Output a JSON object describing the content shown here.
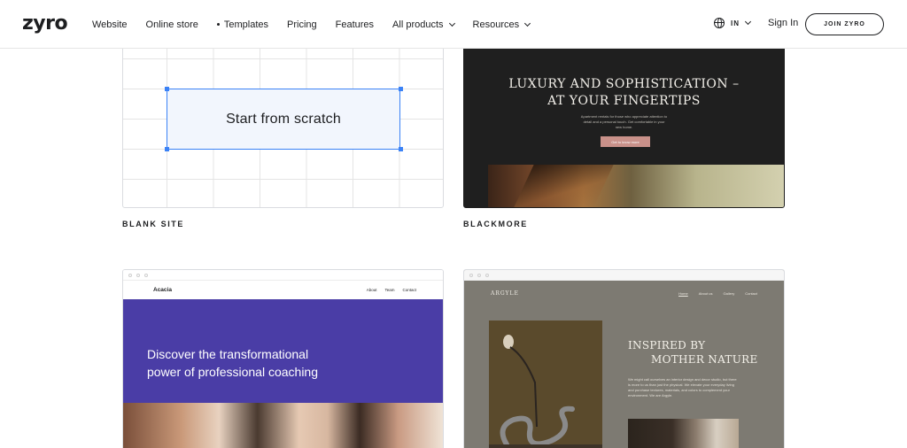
{
  "header": {
    "logo": "zyro",
    "nav": [
      {
        "label": "Website",
        "dot": false,
        "dropdown": false
      },
      {
        "label": "Online store",
        "dot": false,
        "dropdown": false
      },
      {
        "label": "Templates",
        "dot": true,
        "dropdown": false
      },
      {
        "label": "Pricing",
        "dot": false,
        "dropdown": false
      },
      {
        "label": "Features",
        "dot": false,
        "dropdown": false
      },
      {
        "label": "All products",
        "dot": false,
        "dropdown": true
      },
      {
        "label": "Resources",
        "dot": false,
        "dropdown": true
      }
    ],
    "language": "IN",
    "sign_in": "Sign In",
    "join": "JOIN ZYRO"
  },
  "templates": {
    "blank": {
      "name": "BLANK SITE",
      "preview_text": "Start from scratch"
    },
    "blackmore": {
      "name": "BLACKMORE",
      "headline_line1": "LUXURY AND SOPHISTICATION –",
      "headline_line2": "AT YOUR FINGERTIPS",
      "sub": "Apartment rentals for those who appreciate attention to detail and a personal touch. Get comfortable in your new home.",
      "button": "Get to know more"
    },
    "acacia": {
      "logo": "Acacia",
      "links": [
        "About",
        "Team",
        "Contact"
      ],
      "headline_line1": "Discover the transformational",
      "headline_line2": "power of professional coaching"
    },
    "argyle": {
      "logo": "ARGYLE",
      "links": [
        "Home",
        "About us",
        "Gallery",
        "Contact"
      ],
      "headline_line1": "INSPIRED BY",
      "headline_line2": "MOTHER NATURE",
      "body": "We might call ourselves an interior design and decor studio, but there is more to us than just the physical. We elevate your everyday living and purchase textures, materials, and colors to complement your environment. We are Argyle."
    }
  },
  "colors": {
    "accent_blue": "#3b82f6",
    "acacia_purple": "#4a3da6",
    "argyle_bg": "#7d7a72",
    "blackmore_bg": "#1f1f1f"
  }
}
